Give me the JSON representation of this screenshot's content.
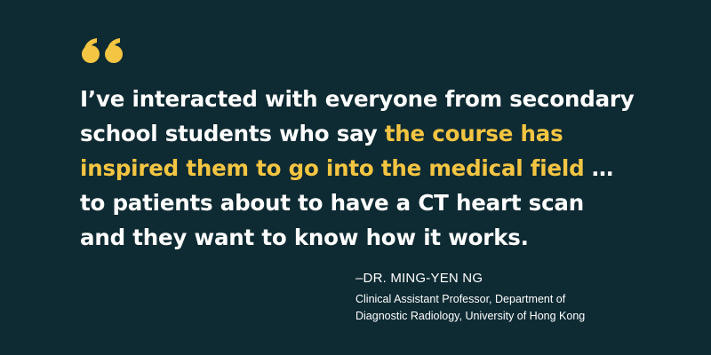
{
  "colors": {
    "background": "#0e2a32",
    "text": "#ffffff",
    "accent": "#f4c542"
  },
  "quote": {
    "icon": "quote-icon",
    "line1": "I’ve interacted with everyone from secondary",
    "line2_plain": "school students who say ",
    "line2_highlight": "the course has",
    "line3_highlight": "inspired them to go into the medical field",
    "line3_plain": " …",
    "line4": "to patients about to have a CT heart scan",
    "line5": "and they want to know how it works."
  },
  "attribution": {
    "name": "–DR. MING-YEN NG",
    "role_line1": "Clinical Assistant Professor, Department of",
    "role_line2": "Diagnostic Radiology, University of Hong Kong"
  }
}
